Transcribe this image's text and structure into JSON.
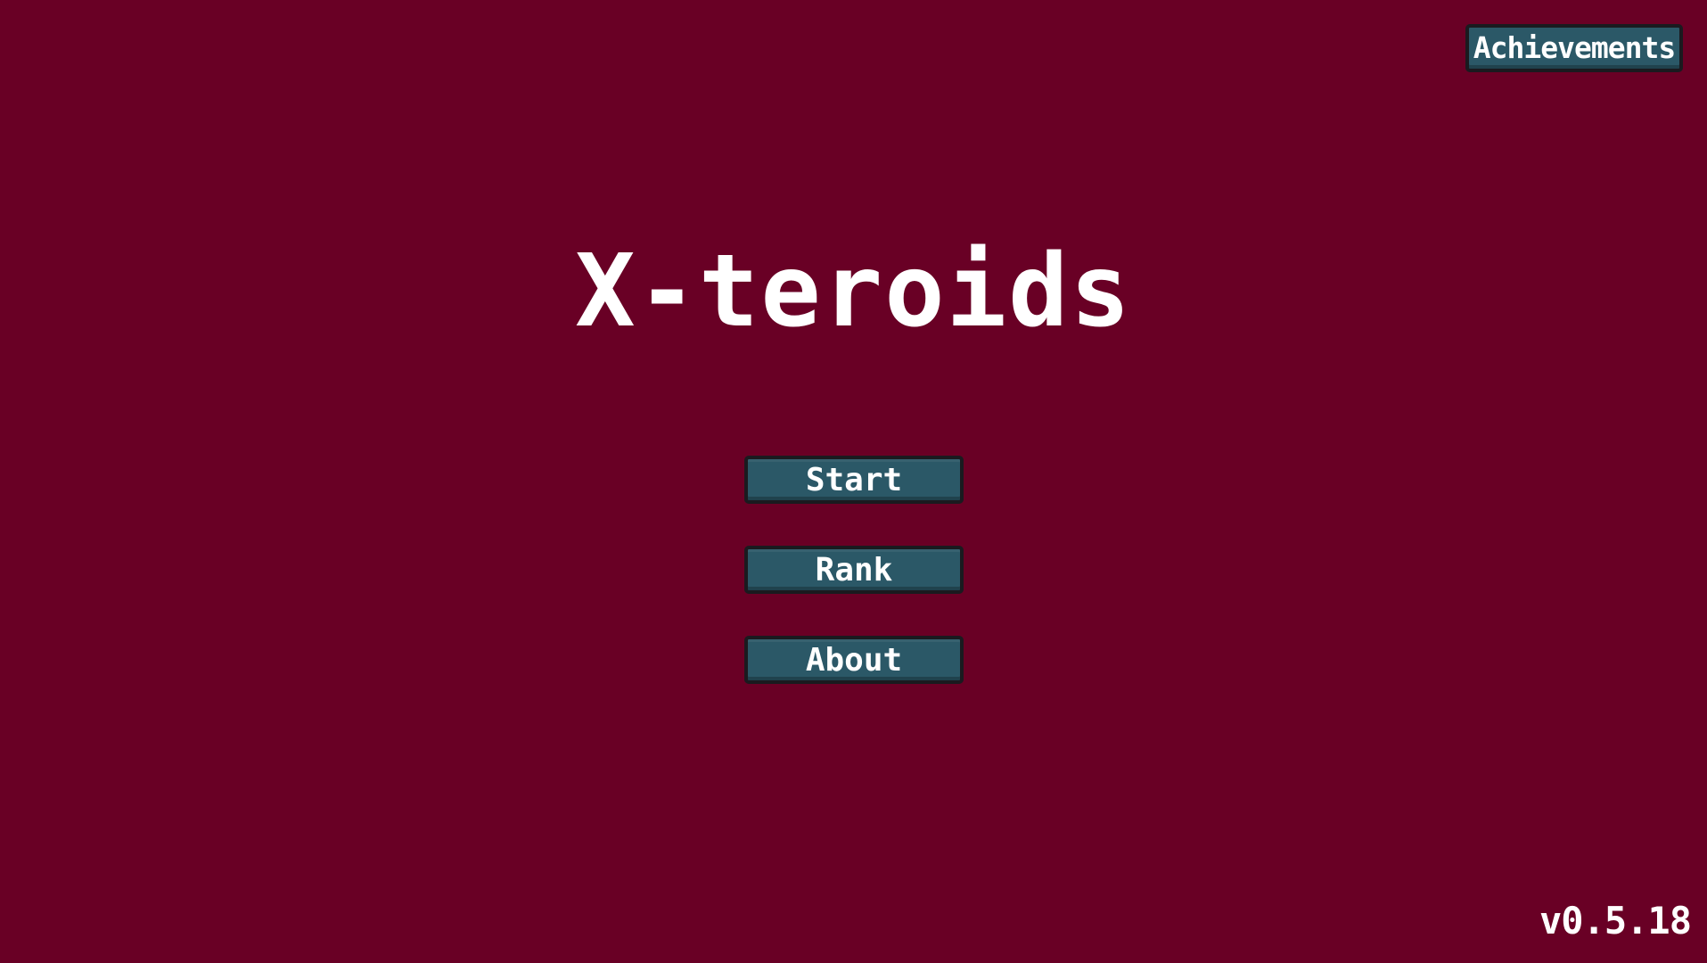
{
  "colors": {
    "background": "#690025",
    "button_fill": "#2b5867",
    "button_border": "#1a1a1f",
    "text": "#ffffff"
  },
  "title": "X-teroids",
  "menu": {
    "start_label": "Start",
    "rank_label": "Rank",
    "about_label": "About"
  },
  "achievements_label": "Achievements",
  "version": "v0.5.18"
}
